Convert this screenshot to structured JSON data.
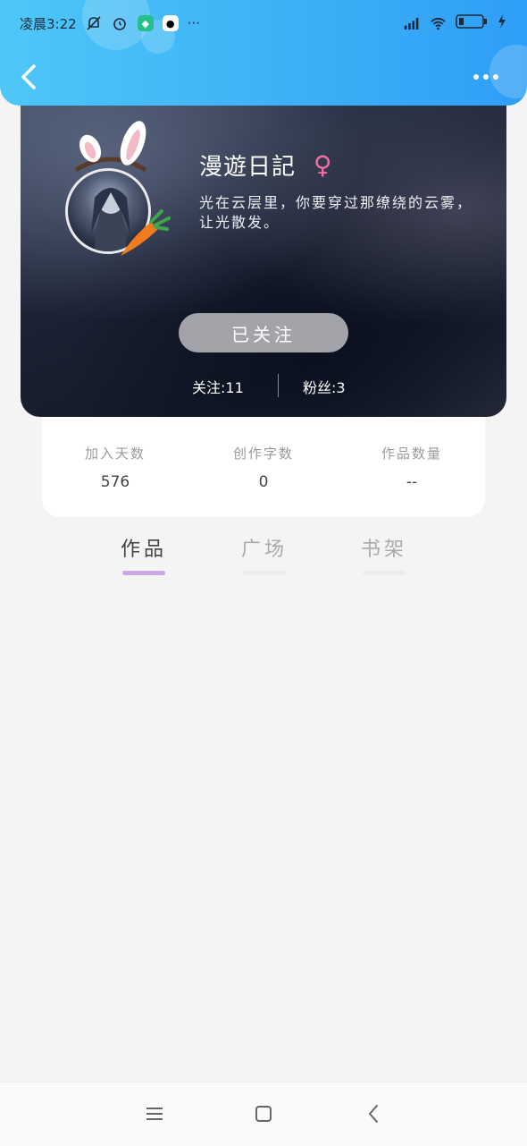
{
  "status_bar": {
    "time": "凌晨3:22",
    "more_dots": "···"
  },
  "header": {
    "back_icon": "back-arrow-icon",
    "more_icon": "more-dots-icon"
  },
  "profile": {
    "nickname": "漫遊日記",
    "gender_symbol": "♀",
    "signature": "光在云层里，你要穿过那缭绕的云雾，让光散发。",
    "follow_button_label": "已关注",
    "following": "关注:11",
    "followers": "粉丝:3"
  },
  "stats": [
    {
      "label": "加入天数",
      "value": "576"
    },
    {
      "label": "创作字数",
      "value": "0"
    },
    {
      "label": "作品数量",
      "value": "--"
    }
  ],
  "tabs": [
    {
      "label": "作品",
      "active": true
    },
    {
      "label": "广场",
      "active": false
    },
    {
      "label": "书架",
      "active": false
    }
  ],
  "colors": {
    "header_gradient_start": "#4ec7f7",
    "header_gradient_end": "#2f9ef6",
    "active_tab_underline": "#c9a8e6",
    "gender_pink": "#f26fa5",
    "follow_button_bg": "#a3a4aa"
  },
  "bottom_nav": {
    "menu_icon": "menu-icon",
    "home_icon": "home-square-icon",
    "back_icon": "nav-back-icon"
  }
}
